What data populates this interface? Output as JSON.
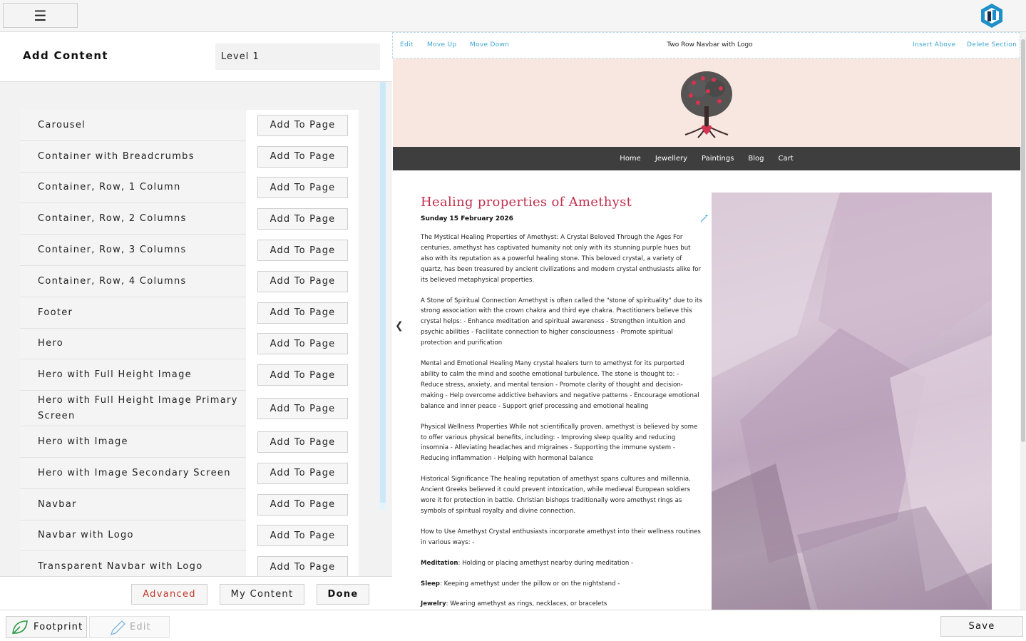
{
  "topbar": {
    "menu_glyph": "☰",
    "logo_icon": "hex-logo-icon"
  },
  "panel": {
    "title": "Add Content",
    "level": "Level 1",
    "add_label": "Add To Page",
    "items": [
      "Carousel",
      "Container with Breadcrumbs",
      "Container, Row, 1 Column",
      "Container, Row, 2 Columns",
      "Container, Row, 3 Columns",
      "Container, Row, 4 Columns",
      "Footer",
      "Hero",
      "Hero with Full Height Image",
      "Hero with Full Height Image Primary Screen",
      "Hero with Image",
      "Hero with Image Secondary Screen",
      "Navbar",
      "Navbar with Logo",
      "Transparent Navbar with Logo"
    ],
    "advanced": "Advanced",
    "my_content": "My Content",
    "done": "Done"
  },
  "section": {
    "edit": "Edit",
    "move_up": "Move Up",
    "move_down": "Move Down",
    "title": "Two Row Navbar with Logo",
    "insert_above": "Insert Above",
    "delete": "Delete Section"
  },
  "site_nav": [
    "Home",
    "Jewellery",
    "Paintings",
    "Blog",
    "Cart"
  ],
  "blog": {
    "title": "Healing properties of Amethyst",
    "date": "Sunday 15 February 2026",
    "paragraphs": [
      "The Mystical Healing Properties of Amethyst: A Crystal Beloved Through the Ages For centuries, amethyst has captivated humanity not only with its stunning purple hues but also with its reputation as a powerful healing stone. This beloved crystal, a variety of quartz, has been treasured by ancient civilizations and modern crystal enthusiasts alike for its believed metaphysical properties.",
      "A Stone of Spiritual Connection Amethyst is often called the \"stone of spirituality\" due to its strong association with the crown chakra and third eye chakra. Practitioners believe this crystal helps: - Enhance meditation and spiritual awareness - Strengthen intuition and psychic abilities - Facilitate connection to higher consciousness - Promote spiritual protection and purification",
      "Mental and Emotional Healing Many crystal healers turn to amethyst for its purported ability to calm the mind and soothe emotional turbulence. The stone is thought to: - Reduce stress, anxiety, and mental tension - Promote clarity of thought and decision-making - Help overcome addictive behaviors and negative patterns - Encourage emotional balance and inner peace - Support grief processing and emotional healing",
      "Physical Wellness Properties While not scientifically proven, amethyst is believed by some to offer various physical benefits, including: - Improving sleep quality and reducing insomnia - Alleviating headaches and migraines - Supporting the immune system - Reducing inflammation - Helping with hormonal balance",
      "Historical Significance The healing reputation of amethyst spans cultures and millennia. Ancient Greeks believed it could prevent intoxication, while medieval European soldiers wore it for protection in battle. Christian bishops traditionally wore amethyst rings as symbols of spiritual royalty and divine connection.",
      "How to Use Amethyst Crystal enthusiasts incorporate amethyst into their wellness routines in various ways: -"
    ],
    "meditation_label": "Meditation",
    "meditation_text": ": Holding or placing amethyst nearby during meditation -",
    "sleep_label": "Sleep",
    "sleep_text": ": Keeping amethyst under the pillow or on the nightstand -",
    "jewelry_label": "Jewelry",
    "jewelry_text": ": Wearing amethyst as rings, necklaces, or bracelets"
  },
  "footer": {
    "footprint": "Footprint",
    "edit": "Edit",
    "save": "Save"
  },
  "colors": {
    "accent_link": "#3fa6d1",
    "title_red": "#c0304d",
    "nav_bg": "#3e3e3e",
    "banner_bg": "#f8e7e0"
  }
}
